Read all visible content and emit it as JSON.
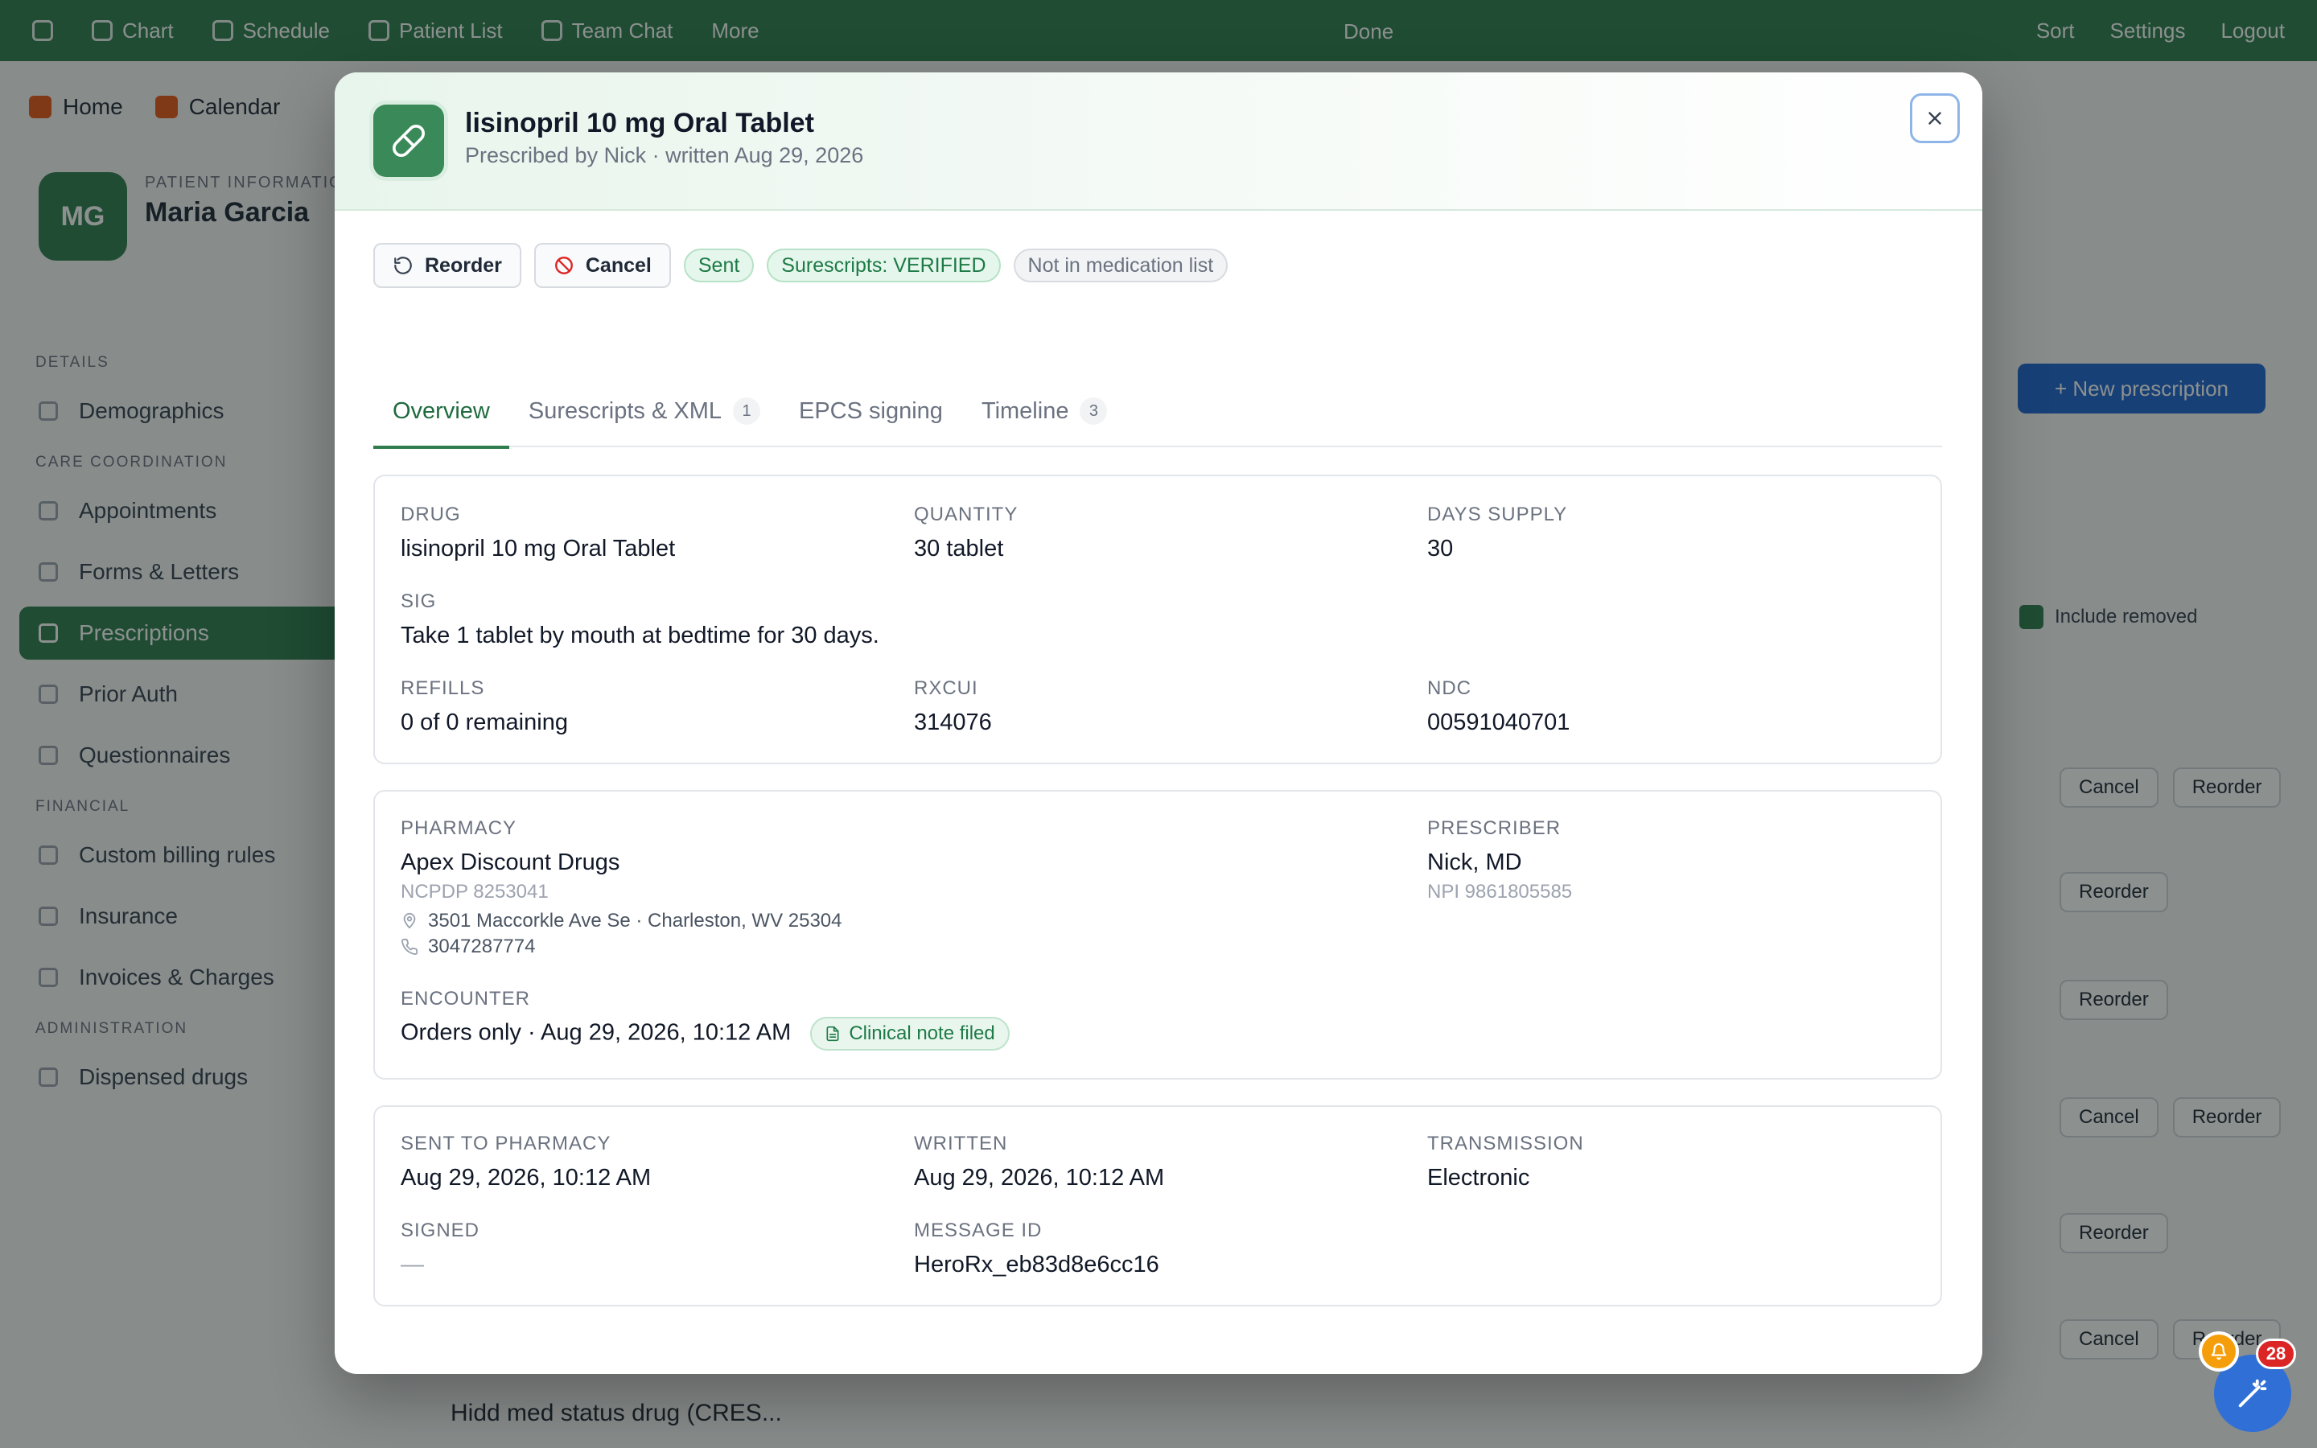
{
  "background": {
    "topnav": [
      "Chart",
      "Schedule",
      "Patient List",
      "Team Chat",
      "More"
    ],
    "topnav_center": "Done",
    "topnav_right": [
      "Sort",
      "Settings",
      "Logout"
    ],
    "subnav": [
      "Home",
      "Calendar"
    ],
    "patient": {
      "label": "PATIENT INFORMATION",
      "name": "Maria Garcia",
      "initials": "MG"
    },
    "sidebar": {
      "sec1": "Details",
      "item_demographics": "Demographics",
      "sec2": "Care coordination",
      "items": [
        "Appointments",
        "Forms & Letters",
        "Prescriptions",
        "Prior Auth",
        "Questionnaires"
      ],
      "sec3": "Financial",
      "fin_items": [
        "Custom billing rules",
        "Insurance",
        "Invoices & Charges"
      ],
      "sec4": "Administration",
      "admin_items": [
        "Dispensed drugs"
      ]
    },
    "action_button": "+ New prescription",
    "toggle": "Include removed",
    "row_buttons": [
      "Cancel",
      "Reorder"
    ],
    "bottom_row": "Hidd med status drug (CRES..."
  },
  "modal": {
    "title": "lisinopril 10 mg Oral Tablet",
    "subtitle": "Prescribed by Nick · written Aug 29, 2026",
    "actions": {
      "reorder": "Reorder",
      "cancel": "Cancel"
    },
    "badges": {
      "sent": "Sent",
      "surescripts": "Surescripts: VERIFIED",
      "medlist": "Not in medication list"
    },
    "tabs": [
      {
        "label": "Overview",
        "count": ""
      },
      {
        "label": "Surescripts & XML",
        "count": "1"
      },
      {
        "label": "EPCS signing",
        "count": ""
      },
      {
        "label": "Timeline",
        "count": "3"
      }
    ],
    "details": {
      "drug_label": "DRUG",
      "drug": "lisinopril 10 mg Oral Tablet",
      "quantity_label": "QUANTITY",
      "quantity": "30 tablet",
      "days_label": "DAYS SUPPLY",
      "days": "30",
      "sig_label": "SIG",
      "sig": "Take 1 tablet by mouth at bedtime for 30 days.",
      "refills_label": "REFILLS",
      "refills": "0 of 0 remaining",
      "rxcui_label": "RXCUI",
      "rxcui": "314076",
      "ndc_label": "NDC",
      "ndc": "00591040701"
    },
    "pharmacy": {
      "label": "PHARMACY",
      "name": "Apex Discount Drugs",
      "ncpdp": "NCPDP 8253041",
      "address": "3501 Maccorkle Ave Se · Charleston, WV 25304",
      "phone": "3047287774",
      "prescriber_label": "PRESCRIBER",
      "prescriber": "Nick, MD",
      "npi": "NPI 9861805585",
      "encounter_label": "ENCOUNTER",
      "encounter": "Orders only · Aug 29, 2026, 10:12 AM",
      "note_badge": "Clinical note filed"
    },
    "transmission": {
      "sent_label": "SENT TO PHARMACY",
      "sent": "Aug 29, 2026, 10:12 AM",
      "written_label": "WRITTEN",
      "written": "Aug 29, 2026, 10:12 AM",
      "transmission_label": "TRANSMISSION",
      "transmission": "Electronic",
      "signed_label": "SIGNED",
      "signed": "—",
      "message_label": "MESSAGE ID",
      "message": "HeroRx_eb83d8e6cc16"
    }
  },
  "notifications": {
    "count": "28"
  },
  "colors": {
    "brand_green": "#2f7d4f",
    "accent_blue": "#2f6fd6",
    "badge_red": "#dc2626"
  }
}
